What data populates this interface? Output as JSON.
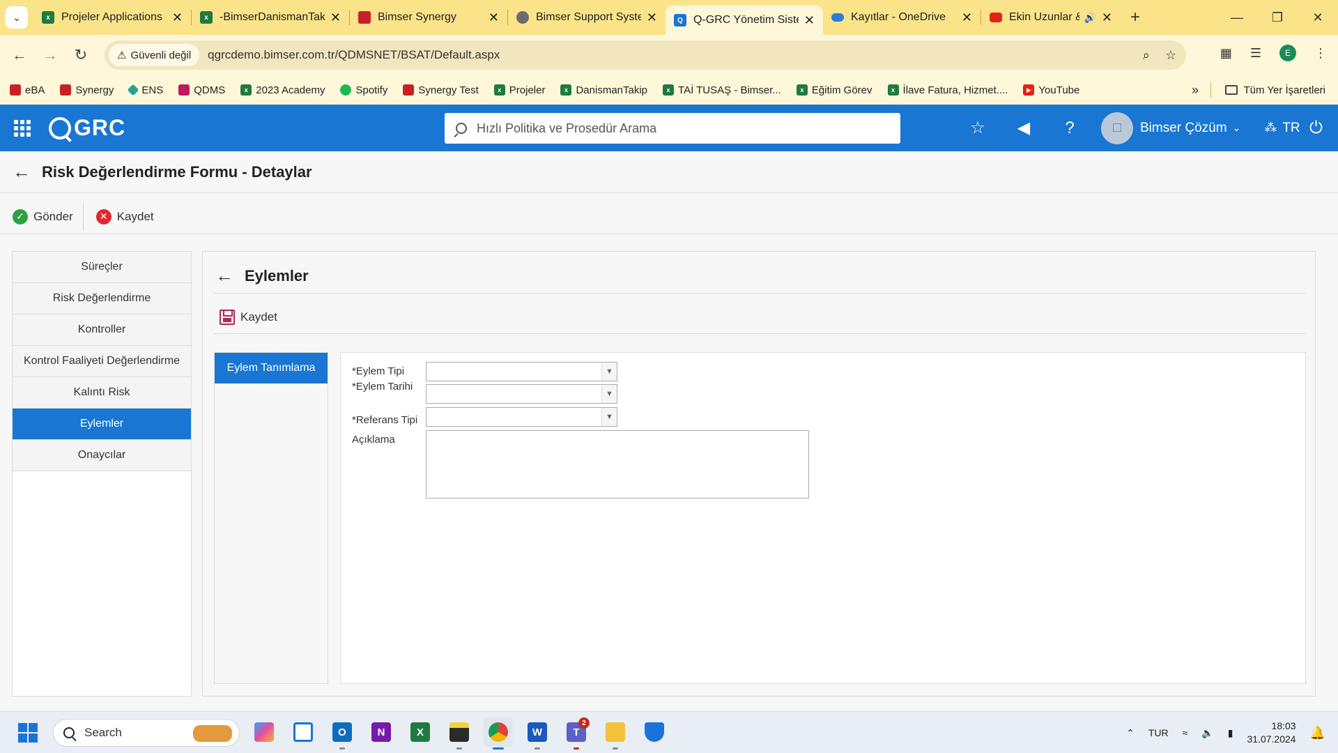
{
  "browser": {
    "tabs": [
      {
        "title": "Projeler Applications",
        "icon": "excel-icon"
      },
      {
        "title": "-BimserDanismanTak",
        "icon": "excel-icon"
      },
      {
        "title": "Bimser Synergy",
        "icon": "synergy-icon"
      },
      {
        "title": "Bimser Support Syste",
        "icon": "globe-icon"
      },
      {
        "title": "Q-GRC Yönetim Siste",
        "icon": "grc-icon",
        "active": true
      },
      {
        "title": "Kayıtlar - OneDrive",
        "icon": "onedrive-icon"
      },
      {
        "title": "Ekin Uzunlar & D",
        "icon": "youtube-icon",
        "audio": true
      }
    ],
    "security_label": "Güvenli değil",
    "url": "qgrcdemo.bimser.com.tr/QDMSNET/BSAT/Default.aspx",
    "profile_initial": "E",
    "bookmarks": [
      {
        "label": "eBA",
        "color": "#c72127"
      },
      {
        "label": "Synergy",
        "color": "#c72127"
      },
      {
        "label": "ENS",
        "color": "#2aa198"
      },
      {
        "label": "QDMS",
        "color": "#c2185b"
      },
      {
        "label": "2023 Academy",
        "color": "#1f7a3f"
      },
      {
        "label": "Spotify",
        "color": "#1db954"
      },
      {
        "label": "Synergy Test",
        "color": "#c72127"
      },
      {
        "label": "Projeler",
        "color": "#1f7a3f"
      },
      {
        "label": "DanismanTakip",
        "color": "#1f7a3f"
      },
      {
        "label": "TAİ TUSAŞ - Bimser...",
        "color": "#1f7a3f"
      },
      {
        "label": "Eğitim Görev",
        "color": "#1f7a3f"
      },
      {
        "label": "İlave Fatura, Hizmet....",
        "color": "#1f7a3f"
      },
      {
        "label": "YouTube",
        "color": "#e62117"
      }
    ],
    "all_bookmarks_label": "Tüm Yer İşaretleri"
  },
  "app": {
    "logo_text": "GRC",
    "search_placeholder": "Hızlı Politika ve Prosedür Arama",
    "user_name": "Bimser Çözüm",
    "language": "TR"
  },
  "page": {
    "title": "Risk Değerlendirme Formu - Detaylar",
    "toolbar": {
      "send_label": "Gönder",
      "save_label": "Kaydet"
    },
    "nav_items": [
      {
        "label": "Süreçler",
        "active": false
      },
      {
        "label": "Risk Değerlendirme",
        "active": false
      },
      {
        "label": "Kontroller",
        "active": false
      },
      {
        "label": "Kontrol Faaliyeti Değerlendirme",
        "active": false
      },
      {
        "label": "Kalıntı Risk",
        "active": false
      },
      {
        "label": "Eylemler",
        "active": true
      },
      {
        "label": "Onaycılar",
        "active": false
      }
    ]
  },
  "content": {
    "title": "Eylemler",
    "save_label": "Kaydet",
    "subtab_label": "Eylem Tanımlama",
    "form": {
      "action_type_label": "*Eylem Tipi",
      "action_type_value": "",
      "action_date_label": "*Eylem Tarihi",
      "action_date_value": "",
      "reference_type_label": "*Referans Tipi",
      "reference_type_value": "",
      "description_label": "Açıklama",
      "description_value": ""
    }
  },
  "taskbar": {
    "search_label": "Search",
    "language": "TUR",
    "time": "18:03",
    "date": "31.07.2024",
    "teams_badge": "2"
  }
}
